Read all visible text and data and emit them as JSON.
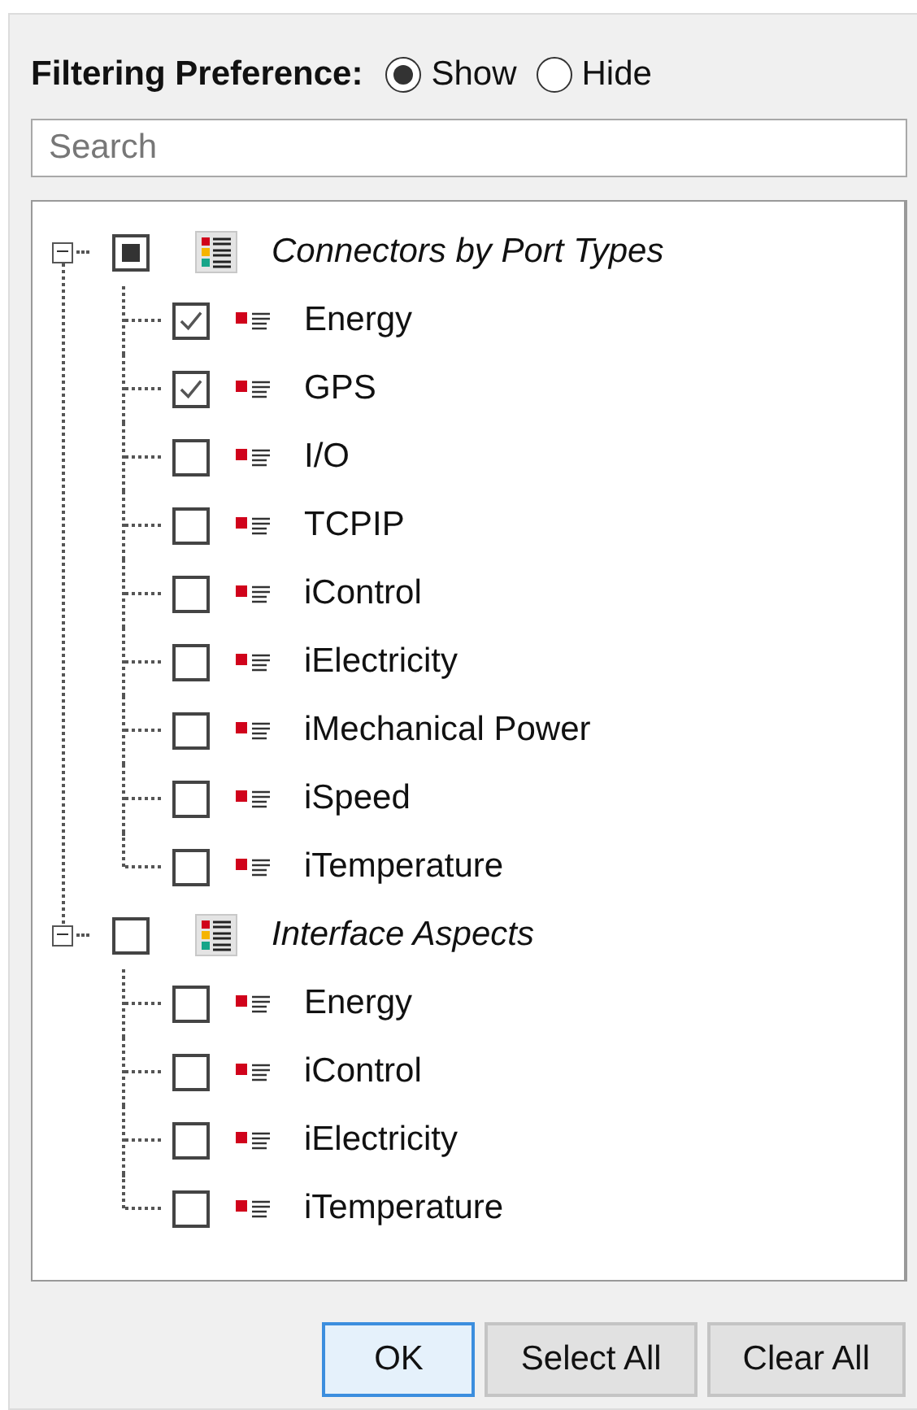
{
  "filter": {
    "label": "Filtering Preference:",
    "options": [
      {
        "label": "Show",
        "selected": true
      },
      {
        "label": "Hide",
        "selected": false
      }
    ]
  },
  "search": {
    "placeholder": "Search"
  },
  "tree": [
    {
      "label": "Connectors by Port Types",
      "expanded": true,
      "checked": false,
      "partial": true,
      "children": [
        {
          "label": "Energy",
          "checked": true
        },
        {
          "label": "GPS",
          "checked": true
        },
        {
          "label": "I/O",
          "checked": false
        },
        {
          "label": "TCPIP",
          "checked": false
        },
        {
          "label": "iControl",
          "checked": false
        },
        {
          "label": "iElectricity",
          "checked": false
        },
        {
          "label": "iMechanical Power",
          "checked": false
        },
        {
          "label": "iSpeed",
          "checked": false
        },
        {
          "label": "iTemperature",
          "checked": false
        }
      ]
    },
    {
      "label": "Interface Aspects",
      "expanded": true,
      "checked": false,
      "partial": false,
      "children": [
        {
          "label": "Energy",
          "checked": false
        },
        {
          "label": "iControl",
          "checked": false
        },
        {
          "label": "iElectricity",
          "checked": false
        },
        {
          "label": "iTemperature",
          "checked": false
        }
      ]
    }
  ],
  "buttons": [
    {
      "label": "OK",
      "default": true
    },
    {
      "label": "Select All",
      "default": false
    },
    {
      "label": "Clear All",
      "default": false
    }
  ]
}
